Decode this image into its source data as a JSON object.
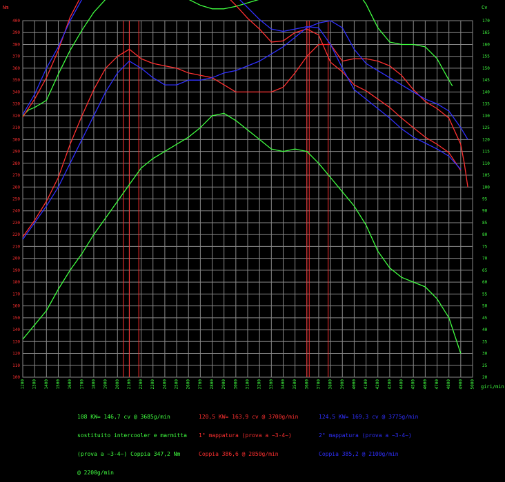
{
  "chart_data": {
    "type": "line",
    "left_axis_label": "Nm",
    "right_axis_label": "Cv",
    "x_unit_label": "giri/min",
    "xlim": [
      1200,
      5000
    ],
    "ylim_left": [
      100,
      400
    ],
    "ylim_right": [
      20,
      170
    ],
    "x_ticks": [
      1200,
      1300,
      1400,
      1500,
      1600,
      1700,
      1800,
      1900,
      2000,
      2100,
      2200,
      2300,
      2400,
      2500,
      2600,
      2700,
      2800,
      2900,
      3000,
      3100,
      3200,
      3300,
      3400,
      3500,
      3600,
      3700,
      3800,
      3900,
      4000,
      4100,
      4200,
      4300,
      4400,
      4500,
      4600,
      4700,
      4800,
      4900,
      5000
    ],
    "y_left_ticks": [
      100,
      110,
      120,
      130,
      140,
      150,
      160,
      170,
      180,
      190,
      200,
      210,
      220,
      230,
      240,
      250,
      260,
      270,
      280,
      290,
      300,
      310,
      320,
      330,
      340,
      350,
      360,
      370,
      380,
      390,
      400
    ],
    "y_right_ticks": [
      20,
      25,
      30,
      35,
      40,
      45,
      50,
      55,
      60,
      65,
      70,
      75,
      80,
      85,
      90,
      95,
      100,
      105,
      110,
      115,
      120,
      125,
      130,
      135,
      140,
      145,
      150,
      155,
      160,
      165,
      170
    ],
    "grid": true,
    "vertical_markers": [
      {
        "x": 2050,
        "color": "#ff3030"
      },
      {
        "x": 2100,
        "color": "#ff3030"
      },
      {
        "x": 2180,
        "color": "#ff3030"
      },
      {
        "x": 3600,
        "color": "#ff3030"
      },
      {
        "x": 3620,
        "color": "#ff3030"
      },
      {
        "x": 3780,
        "color": "#ff3030"
      }
    ],
    "series": [
      {
        "color": "#40ff40",
        "axis": "left",
        "values": [
          [
            1200,
            320
          ],
          [
            1250,
            325
          ],
          [
            1300,
            327
          ],
          [
            1400,
            333
          ],
          [
            1500,
            355
          ],
          [
            1600,
            375
          ],
          [
            1700,
            392
          ],
          [
            1800,
            407
          ],
          [
            1900,
            418
          ],
          [
            2000,
            428
          ],
          [
            2100,
            440
          ],
          [
            2200,
            448
          ],
          [
            2300,
            446
          ],
          [
            2400,
            435
          ],
          [
            2500,
            425
          ],
          [
            2600,
            418
          ],
          [
            2700,
            413
          ],
          [
            2800,
            410
          ],
          [
            2900,
            410
          ],
          [
            3000,
            412
          ],
          [
            3100,
            415
          ],
          [
            3200,
            418
          ],
          [
            3300,
            420
          ],
          [
            3400,
            430
          ],
          [
            3500,
            438
          ],
          [
            3600,
            446
          ],
          [
            3700,
            446
          ],
          [
            3800,
            438
          ],
          [
            3900,
            434
          ],
          [
            4000,
            428
          ],
          [
            4100,
            414
          ],
          [
            4200,
            394
          ],
          [
            4300,
            382
          ],
          [
            4400,
            380
          ],
          [
            4500,
            380
          ],
          [
            4600,
            378
          ],
          [
            4700,
            368
          ],
          [
            4800,
            350
          ],
          [
            4830,
            345
          ]
        ]
      },
      {
        "color": "#40ff40",
        "axis": "right",
        "values": [
          [
            1200,
            36
          ],
          [
            1300,
            42
          ],
          [
            1400,
            48
          ],
          [
            1500,
            57
          ],
          [
            1600,
            65
          ],
          [
            1700,
            72
          ],
          [
            1800,
            80
          ],
          [
            1900,
            87
          ],
          [
            2000,
            94
          ],
          [
            2100,
            101
          ],
          [
            2200,
            108
          ],
          [
            2300,
            112
          ],
          [
            2400,
            115
          ],
          [
            2500,
            118
          ],
          [
            2600,
            121
          ],
          [
            2700,
            125
          ],
          [
            2800,
            130
          ],
          [
            2900,
            131
          ],
          [
            3000,
            128
          ],
          [
            3100,
            124
          ],
          [
            3200,
            120
          ],
          [
            3300,
            116
          ],
          [
            3400,
            115
          ],
          [
            3500,
            116
          ],
          [
            3600,
            115
          ],
          [
            3700,
            110
          ],
          [
            3800,
            104
          ],
          [
            3900,
            98
          ],
          [
            4000,
            92
          ],
          [
            4100,
            84
          ],
          [
            4200,
            73
          ],
          [
            4300,
            66
          ],
          [
            4400,
            62
          ],
          [
            4500,
            60
          ],
          [
            4600,
            58
          ],
          [
            4700,
            53
          ],
          [
            4800,
            45
          ],
          [
            4900,
            30
          ]
        ]
      },
      {
        "color": "#ff3030",
        "axis": "left",
        "values": [
          [
            1200,
            319
          ],
          [
            1300,
            334
          ],
          [
            1400,
            352
          ],
          [
            1500,
            375
          ],
          [
            1600,
            403
          ],
          [
            1700,
            422
          ],
          [
            1800,
            443
          ],
          [
            1900,
            455
          ],
          [
            2000,
            464
          ],
          [
            2100,
            463
          ],
          [
            2200,
            453
          ],
          [
            2300,
            443
          ],
          [
            2400,
            440
          ],
          [
            2500,
            440
          ],
          [
            2600,
            436
          ],
          [
            2700,
            430
          ],
          [
            2800,
            427
          ],
          [
            2900,
            423
          ],
          [
            3000,
            413
          ],
          [
            3100,
            402
          ],
          [
            3200,
            393
          ],
          [
            3300,
            382
          ],
          [
            3400,
            383
          ],
          [
            3500,
            390
          ],
          [
            3600,
            393
          ],
          [
            3700,
            388
          ],
          [
            3800,
            365
          ],
          [
            3900,
            357
          ],
          [
            4000,
            346
          ],
          [
            4100,
            341
          ],
          [
            4200,
            334
          ],
          [
            4300,
            327
          ],
          [
            4400,
            318
          ],
          [
            4500,
            310
          ],
          [
            4600,
            302
          ],
          [
            4700,
            296
          ],
          [
            4800,
            289
          ],
          [
            4900,
            274
          ]
        ]
      },
      {
        "color": "#ff3030",
        "axis": "right",
        "values": [
          [
            1200,
            79
          ],
          [
            1300,
            86
          ],
          [
            1400,
            94
          ],
          [
            1500,
            104
          ],
          [
            1600,
            118
          ],
          [
            1700,
            130
          ],
          [
            1800,
            141
          ],
          [
            1900,
            150
          ],
          [
            2000,
            155
          ],
          [
            2100,
            158
          ],
          [
            2200,
            154
          ],
          [
            2300,
            152
          ],
          [
            2400,
            151
          ],
          [
            2500,
            150
          ],
          [
            2600,
            148
          ],
          [
            2700,
            147
          ],
          [
            2800,
            146
          ],
          [
            2900,
            143
          ],
          [
            3000,
            140
          ],
          [
            3100,
            140
          ],
          [
            3200,
            140
          ],
          [
            3300,
            140
          ],
          [
            3400,
            142
          ],
          [
            3500,
            148
          ],
          [
            3600,
            155
          ],
          [
            3700,
            160
          ],
          [
            3800,
            160
          ],
          [
            3900,
            153
          ],
          [
            4000,
            154
          ],
          [
            4100,
            154
          ],
          [
            4200,
            153
          ],
          [
            4300,
            151
          ],
          [
            4400,
            147
          ],
          [
            4500,
            141
          ],
          [
            4600,
            136
          ],
          [
            4700,
            133
          ],
          [
            4800,
            129
          ],
          [
            4900,
            118
          ],
          [
            4930,
            110
          ],
          [
            4960,
            100
          ]
        ]
      },
      {
        "color": "#3030ff",
        "axis": "left",
        "values": [
          [
            1200,
            321
          ],
          [
            1300,
            338
          ],
          [
            1400,
            360
          ],
          [
            1500,
            378
          ],
          [
            1600,
            400
          ],
          [
            1700,
            418
          ],
          [
            1800,
            437
          ],
          [
            1900,
            454
          ],
          [
            2000,
            466
          ],
          [
            2100,
            465
          ],
          [
            2200,
            456
          ],
          [
            2300,
            448
          ],
          [
            2400,
            440
          ],
          [
            2500,
            434
          ],
          [
            2600,
            428
          ],
          [
            2700,
            426
          ],
          [
            2800,
            425
          ],
          [
            2900,
            425
          ],
          [
            3000,
            421
          ],
          [
            3100,
            411
          ],
          [
            3200,
            401
          ],
          [
            3300,
            393
          ],
          [
            3400,
            391
          ],
          [
            3500,
            393
          ],
          [
            3600,
            395
          ],
          [
            3700,
            394
          ],
          [
            3800,
            380
          ],
          [
            3900,
            360
          ],
          [
            4000,
            342
          ],
          [
            4100,
            334
          ],
          [
            4200,
            326
          ],
          [
            4300,
            318
          ],
          [
            4400,
            309
          ],
          [
            4500,
            302
          ],
          [
            4600,
            297
          ],
          [
            4700,
            292
          ],
          [
            4800,
            286
          ],
          [
            4900,
            275
          ]
        ]
      },
      {
        "color": "#3030ff",
        "axis": "right",
        "values": [
          [
            1200,
            78
          ],
          [
            1300,
            85
          ],
          [
            1400,
            92
          ],
          [
            1500,
            100
          ],
          [
            1600,
            110
          ],
          [
            1700,
            120
          ],
          [
            1800,
            130
          ],
          [
            1900,
            140
          ],
          [
            2000,
            148
          ],
          [
            2100,
            153
          ],
          [
            2200,
            150
          ],
          [
            2300,
            146
          ],
          [
            2400,
            143
          ],
          [
            2500,
            143
          ],
          [
            2600,
            145
          ],
          [
            2700,
            145
          ],
          [
            2800,
            146
          ],
          [
            2900,
            148
          ],
          [
            3000,
            149
          ],
          [
            3100,
            151
          ],
          [
            3200,
            153
          ],
          [
            3300,
            156
          ],
          [
            3400,
            159
          ],
          [
            3500,
            163
          ],
          [
            3600,
            167
          ],
          [
            3700,
            169
          ],
          [
            3800,
            170
          ],
          [
            3900,
            167
          ],
          [
            4000,
            158
          ],
          [
            4100,
            152
          ],
          [
            4200,
            149
          ],
          [
            4300,
            146
          ],
          [
            4400,
            143
          ],
          [
            4500,
            140
          ],
          [
            4600,
            137
          ],
          [
            4700,
            135
          ],
          [
            4800,
            132
          ],
          [
            4900,
            125
          ],
          [
            4960,
            120
          ]
        ]
      }
    ]
  },
  "legend": {
    "green_lines": [
      "108 KW= 146,7 cv @ 3685g/min",
      "sostituito intercooler e marmitta",
      "(prova a ~3-4~) Coppia 347,2 Nm",
      "@ 2200g/min"
    ],
    "red_lines": [
      "120,5 KW= 163,9 cv @ 3700g/min",
      "1° mappatura (prova a ~3-4~)",
      "Coppia 386,6 @ 2050g/min"
    ],
    "blue_lines": [
      "124,5 KW= 169,3 cv @ 3775g/min",
      "2° mappatura (prova a ~3-4~)",
      "Coppia 385,2 @ 2100g/min"
    ]
  },
  "colors": {
    "background": "#000000",
    "grid": "#8a8a8a",
    "axis_text": "#40ff40",
    "left_axis_text": "#ff3030"
  }
}
